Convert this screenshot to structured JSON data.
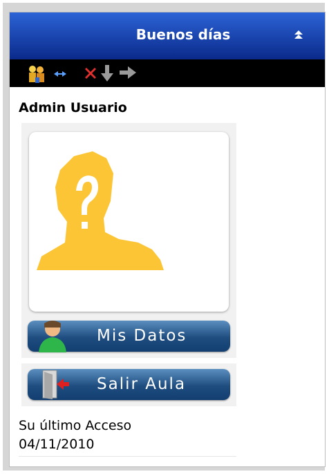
{
  "header": {
    "title": "Buenos días",
    "collapse_icon": "double-chevron-up-icon"
  },
  "toolbar": {
    "icons": [
      "users-icon",
      "link-icon",
      "delete-icon",
      "arrow-down-icon",
      "arrow-right-icon"
    ]
  },
  "user": {
    "name": "Admin Usuario",
    "avatar_icon": "unknown-user-icon"
  },
  "buttons": {
    "mis_datos": {
      "label": "Mis Datos",
      "icon": "user-icon"
    },
    "salir": {
      "label": "Salir Aula",
      "icon": "exit-door-icon"
    }
  },
  "last_access": {
    "label": "Su último Acceso",
    "date": "04/11/2010"
  },
  "colors": {
    "header": "#1a44b8",
    "toolbar": "#000000",
    "button": "#2d5f96",
    "avatar": "#fcc536"
  }
}
